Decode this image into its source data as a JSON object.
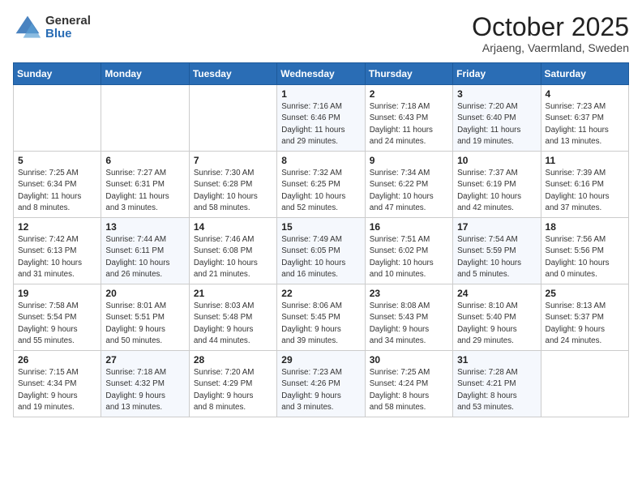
{
  "header": {
    "logo_general": "General",
    "logo_blue": "Blue",
    "month": "October 2025",
    "location": "Arjaeng, Vaermland, Sweden"
  },
  "days_of_week": [
    "Sunday",
    "Monday",
    "Tuesday",
    "Wednesday",
    "Thursday",
    "Friday",
    "Saturday"
  ],
  "weeks": [
    [
      {
        "num": "",
        "info": ""
      },
      {
        "num": "",
        "info": ""
      },
      {
        "num": "",
        "info": ""
      },
      {
        "num": "1",
        "info": "Sunrise: 7:16 AM\nSunset: 6:46 PM\nDaylight: 11 hours\nand 29 minutes."
      },
      {
        "num": "2",
        "info": "Sunrise: 7:18 AM\nSunset: 6:43 PM\nDaylight: 11 hours\nand 24 minutes."
      },
      {
        "num": "3",
        "info": "Sunrise: 7:20 AM\nSunset: 6:40 PM\nDaylight: 11 hours\nand 19 minutes."
      },
      {
        "num": "4",
        "info": "Sunrise: 7:23 AM\nSunset: 6:37 PM\nDaylight: 11 hours\nand 13 minutes."
      }
    ],
    [
      {
        "num": "5",
        "info": "Sunrise: 7:25 AM\nSunset: 6:34 PM\nDaylight: 11 hours\nand 8 minutes."
      },
      {
        "num": "6",
        "info": "Sunrise: 7:27 AM\nSunset: 6:31 PM\nDaylight: 11 hours\nand 3 minutes."
      },
      {
        "num": "7",
        "info": "Sunrise: 7:30 AM\nSunset: 6:28 PM\nDaylight: 10 hours\nand 58 minutes."
      },
      {
        "num": "8",
        "info": "Sunrise: 7:32 AM\nSunset: 6:25 PM\nDaylight: 10 hours\nand 52 minutes."
      },
      {
        "num": "9",
        "info": "Sunrise: 7:34 AM\nSunset: 6:22 PM\nDaylight: 10 hours\nand 47 minutes."
      },
      {
        "num": "10",
        "info": "Sunrise: 7:37 AM\nSunset: 6:19 PM\nDaylight: 10 hours\nand 42 minutes."
      },
      {
        "num": "11",
        "info": "Sunrise: 7:39 AM\nSunset: 6:16 PM\nDaylight: 10 hours\nand 37 minutes."
      }
    ],
    [
      {
        "num": "12",
        "info": "Sunrise: 7:42 AM\nSunset: 6:13 PM\nDaylight: 10 hours\nand 31 minutes."
      },
      {
        "num": "13",
        "info": "Sunrise: 7:44 AM\nSunset: 6:11 PM\nDaylight: 10 hours\nand 26 minutes."
      },
      {
        "num": "14",
        "info": "Sunrise: 7:46 AM\nSunset: 6:08 PM\nDaylight: 10 hours\nand 21 minutes."
      },
      {
        "num": "15",
        "info": "Sunrise: 7:49 AM\nSunset: 6:05 PM\nDaylight: 10 hours\nand 16 minutes."
      },
      {
        "num": "16",
        "info": "Sunrise: 7:51 AM\nSunset: 6:02 PM\nDaylight: 10 hours\nand 10 minutes."
      },
      {
        "num": "17",
        "info": "Sunrise: 7:54 AM\nSunset: 5:59 PM\nDaylight: 10 hours\nand 5 minutes."
      },
      {
        "num": "18",
        "info": "Sunrise: 7:56 AM\nSunset: 5:56 PM\nDaylight: 10 hours\nand 0 minutes."
      }
    ],
    [
      {
        "num": "19",
        "info": "Sunrise: 7:58 AM\nSunset: 5:54 PM\nDaylight: 9 hours\nand 55 minutes."
      },
      {
        "num": "20",
        "info": "Sunrise: 8:01 AM\nSunset: 5:51 PM\nDaylight: 9 hours\nand 50 minutes."
      },
      {
        "num": "21",
        "info": "Sunrise: 8:03 AM\nSunset: 5:48 PM\nDaylight: 9 hours\nand 44 minutes."
      },
      {
        "num": "22",
        "info": "Sunrise: 8:06 AM\nSunset: 5:45 PM\nDaylight: 9 hours\nand 39 minutes."
      },
      {
        "num": "23",
        "info": "Sunrise: 8:08 AM\nSunset: 5:43 PM\nDaylight: 9 hours\nand 34 minutes."
      },
      {
        "num": "24",
        "info": "Sunrise: 8:10 AM\nSunset: 5:40 PM\nDaylight: 9 hours\nand 29 minutes."
      },
      {
        "num": "25",
        "info": "Sunrise: 8:13 AM\nSunset: 5:37 PM\nDaylight: 9 hours\nand 24 minutes."
      }
    ],
    [
      {
        "num": "26",
        "info": "Sunrise: 7:15 AM\nSunset: 4:34 PM\nDaylight: 9 hours\nand 19 minutes."
      },
      {
        "num": "27",
        "info": "Sunrise: 7:18 AM\nSunset: 4:32 PM\nDaylight: 9 hours\nand 13 minutes."
      },
      {
        "num": "28",
        "info": "Sunrise: 7:20 AM\nSunset: 4:29 PM\nDaylight: 9 hours\nand 8 minutes."
      },
      {
        "num": "29",
        "info": "Sunrise: 7:23 AM\nSunset: 4:26 PM\nDaylight: 9 hours\nand 3 minutes."
      },
      {
        "num": "30",
        "info": "Sunrise: 7:25 AM\nSunset: 4:24 PM\nDaylight: 8 hours\nand 58 minutes."
      },
      {
        "num": "31",
        "info": "Sunrise: 7:28 AM\nSunset: 4:21 PM\nDaylight: 8 hours\nand 53 minutes."
      },
      {
        "num": "",
        "info": ""
      }
    ]
  ]
}
